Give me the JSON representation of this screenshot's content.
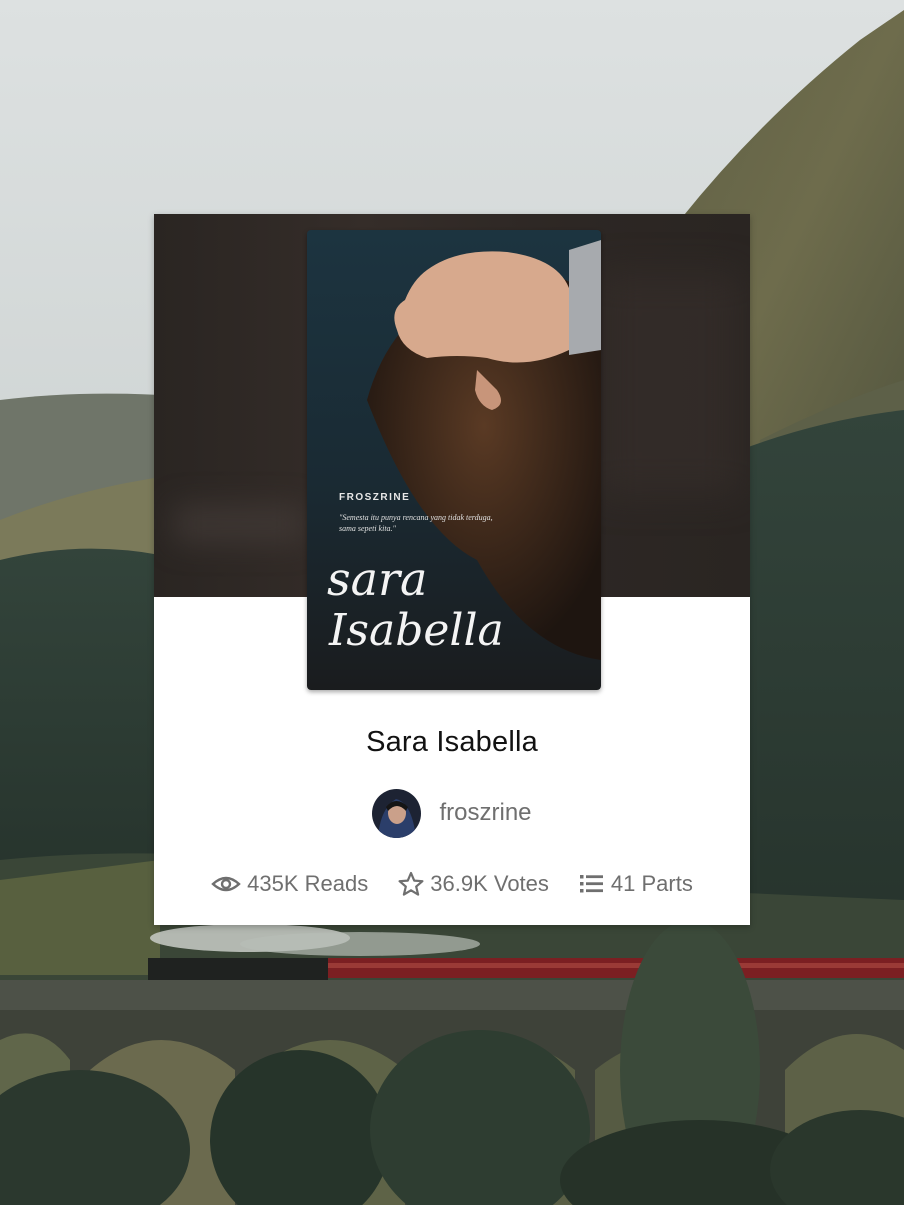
{
  "story": {
    "title": "Sara Isabella",
    "author": "froszrine",
    "cover": {
      "author_caps": "FROSZRINE",
      "quote": "\"Semesta itu punya rencana yang tidak terduga, sama sepeti kita.\"",
      "title_line1": "sara",
      "title_line2": "Isabella"
    },
    "stats": {
      "reads": "435K Reads",
      "votes": "36.9K Votes",
      "parts": "41 Parts"
    }
  },
  "icons": {
    "reads": "eye-icon",
    "votes": "star-icon",
    "parts": "list-icon"
  },
  "colors": {
    "card_background": "#ffffff",
    "header_background": "#2d2724",
    "title_text": "#121212",
    "meta_text": "#6f6f6f"
  }
}
